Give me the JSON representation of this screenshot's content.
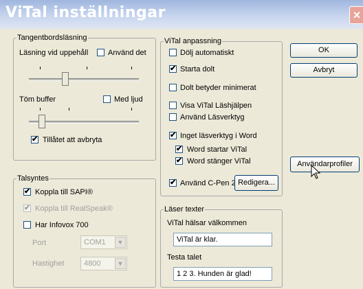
{
  "window": {
    "title": "ViTal inställningar",
    "close_glyph": "×"
  },
  "tangent": {
    "legend": "Tangentbordsläsning",
    "lasning_label": "Läsning vid uppehåll",
    "anvand_det": "Använd det",
    "tom_buffer": "Töm buffer",
    "med_ljud": "Med ljud",
    "tillatet": "Tillåtet att avbryta"
  },
  "talsyntes": {
    "legend": "Talsyntes",
    "sapi": "Koppla till SAPI®",
    "realspeak": "Koppla till RealSpeak®",
    "infovox": "Har Infovox 700",
    "port_label": "Port",
    "port_value": "COM1",
    "hastighet_label": "Hastighet",
    "hastighet_value": "4800"
  },
  "vital": {
    "legend": "ViTal anpassning",
    "dolj": "Dölj automatiskt",
    "starta": "Starta dolt",
    "dolt_betyder": "Dolt betyder minimerat",
    "visa": "Visa ViTal Läshjälpen",
    "anvand_lasverktyg": "Använd Läsverktyg",
    "inget": "Inget läsverktyg i Word",
    "word_startar": "Word startar ViTal",
    "word_stanger": "Word stänger ViTal",
    "cpen": "Använd C-Pen 20",
    "redigera": "Redigera..."
  },
  "laser": {
    "legend": "Läser texter",
    "halsar_label": "ViTal hälsar välkommen",
    "halsar_value": "ViTal är klar.",
    "testa_label": "Testa talet",
    "testa_value": "1 2 3. Hunden är glad!"
  },
  "buttons": {
    "ok": "OK",
    "avbryt": "Avbryt",
    "anvandarprofiler": "Användarprofiler"
  },
  "check": "✔",
  "sliders": {
    "lasning_level": 0.33,
    "tom_level": 0.12
  },
  "colors": {
    "titlebar": "#9fb6de",
    "close": "#e9a49a",
    "face": "#ece9d8"
  },
  "icons": {
    "cursor": "arrow-cursor-icon",
    "dropdown": "chevron-down-icon"
  }
}
